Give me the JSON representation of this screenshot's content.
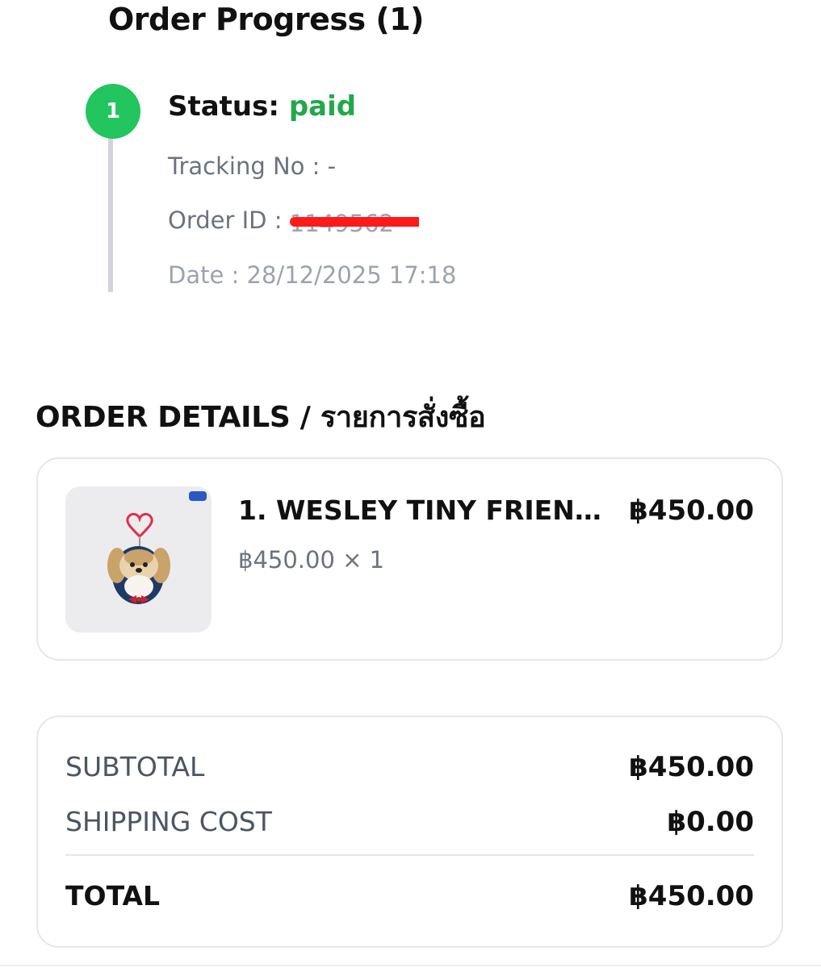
{
  "order_progress": {
    "title": "Order Progress (1)",
    "step_number": "1",
    "status_label": "Status:",
    "status_value": "paid",
    "tracking": "Tracking No : -",
    "order_id_label": "Order ID :",
    "order_id_value": "1149562",
    "date": "Date : 28/12/2025 17:18"
  },
  "order_details": {
    "title": "ORDER DETAILS / รายการสั่งซื้อ",
    "items": [
      {
        "name": "1. WESLEY TINY FRIENDS...",
        "price": "฿450.00",
        "quantity_line": "฿450.00 × 1",
        "image_icon": "plush-keychain-image"
      }
    ]
  },
  "summary": {
    "subtotal_label": "SUBTOTAL",
    "subtotal_value": "฿450.00",
    "shipping_label": "SHIPPING COST",
    "shipping_value": "฿0.00",
    "total_label": "TOTAL",
    "total_value": "฿450.00"
  },
  "colors": {
    "status_green": "#22c55e",
    "paid_text": "#22a84a",
    "redaction": "#ff1a1a"
  }
}
